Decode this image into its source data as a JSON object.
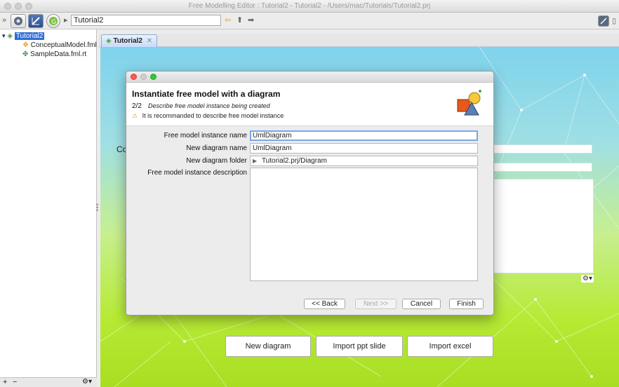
{
  "window": {
    "title": "Free Modelling Editor : Tutorial2 - Tutorial2 - /Users/mac/Tutorials/Tutorial2.prj"
  },
  "toolbar": {
    "path_value": "Tutorial2"
  },
  "tree": {
    "root": "Tutorial2",
    "children": [
      "ConceptualModel.fml",
      "SampleData.fml.rt"
    ]
  },
  "left_bottom": {
    "add": "+",
    "remove": "−",
    "settings": "⚙▾"
  },
  "editor": {
    "tab_label": "Tutorial2",
    "truncated_label": "Co",
    "buttons": {
      "new_diagram": "New diagram",
      "import_ppt": "Import ppt slide",
      "import_excel": "Import excel"
    },
    "gear": "⚙▾"
  },
  "dialog": {
    "title": "Instantiate free model with a diagram",
    "step": "2/2",
    "step_description": "Describe free model instance being created",
    "warning": "It is recommanded to describe free model instance",
    "fields": {
      "instance_name_label": "Free model instance name",
      "instance_name_value": "UmlDiagram",
      "diagram_name_label": "New diagram name",
      "diagram_name_value": "UmlDiagram",
      "diagram_folder_label": "New diagram folder",
      "diagram_folder_value": "Tutorial2.prj/Diagram",
      "description_label": "Free model instance description"
    },
    "buttons": {
      "back": "<< Back",
      "next": "Next >>",
      "cancel": "Cancel",
      "finish": "Finish"
    }
  },
  "colors": {
    "selection": "#2f6dd6",
    "close_dot": "#fc5753",
    "min_dot": "#cfcfcf",
    "max_dot": "#2dc840",
    "focus_border": "#7aa7e6"
  }
}
